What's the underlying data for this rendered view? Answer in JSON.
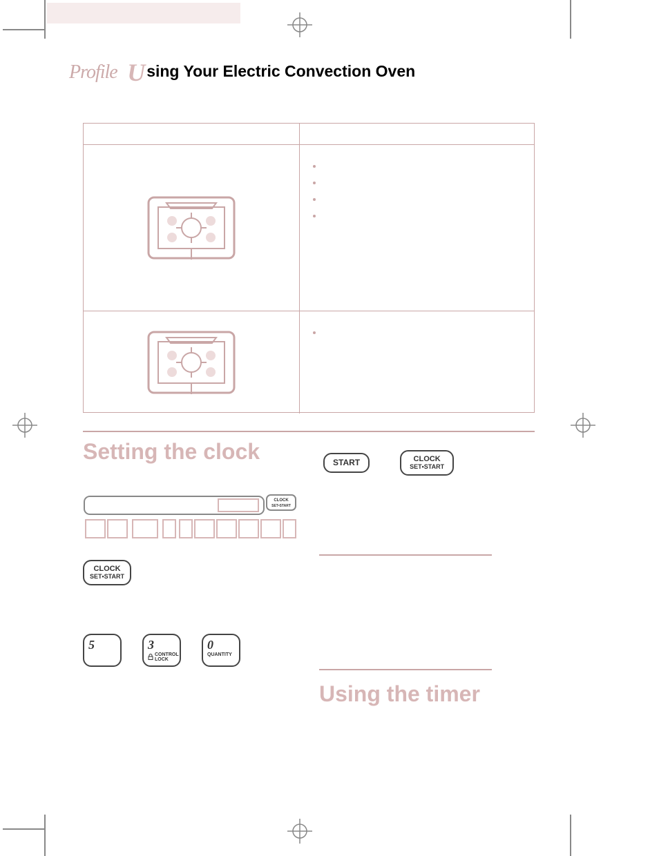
{
  "header": {
    "title_prefix_script": "U",
    "title_rest": "sing Your Electric Convection Oven"
  },
  "table": {
    "rows": [
      {
        "bullets_count": 4
      },
      {
        "bullets_count": 1
      }
    ]
  },
  "sections": {
    "clock": {
      "title": "Setting the clock",
      "buttons": {
        "start": "START",
        "clock_set_start_l1": "CLOCK",
        "clock_set_start_l2": "SET•START"
      },
      "panel_small_btn_l1": "CLOCK",
      "panel_small_btn_l2": "SET•START",
      "small_btn_below_l1": "CLOCK",
      "small_btn_below_l2": "SET•START",
      "pads": [
        {
          "num": "5",
          "sub": ""
        },
        {
          "num": "3",
          "sub_l1": "CONTROL",
          "sub_l2": "LOCK",
          "has_lock_icon": true
        },
        {
          "num": "0",
          "sub_l1": "QUANTITY"
        }
      ]
    },
    "timer": {
      "title": "Using the timer"
    }
  }
}
